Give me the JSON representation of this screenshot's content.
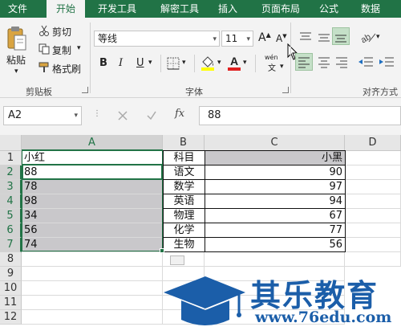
{
  "menu": {
    "tabs": [
      {
        "label": "文件",
        "active": false
      },
      {
        "label": "开始",
        "active": true
      },
      {
        "label": "开发工具",
        "active": false
      },
      {
        "label": "解密工具",
        "active": false
      },
      {
        "label": "插入",
        "active": false
      },
      {
        "label": "页面布局",
        "active": false
      },
      {
        "label": "公式",
        "active": false
      },
      {
        "label": "数据",
        "active": false
      }
    ]
  },
  "ribbon": {
    "clipboard": {
      "paste": "粘贴",
      "cut": "剪切",
      "copy": "复制",
      "format_painter": "格式刷",
      "group_label": "剪贴板"
    },
    "font": {
      "font_name": "等线",
      "font_size": "11",
      "bold": "B",
      "italic": "I",
      "underline": "U",
      "grow": "A",
      "shrink": "A",
      "phonetic": "wén",
      "group_label": "字体"
    },
    "alignment": {
      "group_label": "对齐方式"
    }
  },
  "formula_bar": {
    "name_box": "A2",
    "fx": "fx",
    "value": "88"
  },
  "grid": {
    "columns": [
      "A",
      "B",
      "C",
      "D"
    ],
    "rows": [
      "1",
      "2",
      "3",
      "4",
      "5",
      "6",
      "7",
      "8",
      "9",
      "10",
      "11",
      "12"
    ],
    "cells": {
      "A1": "小红",
      "B1": "科目",
      "C1": "小黑",
      "A2": "88",
      "B2": "语文",
      "C2": "90",
      "A3": "78",
      "B3": "数学",
      "C3": "97",
      "A4": "98",
      "B4": "英语",
      "C4": "94",
      "A5": "34",
      "B5": "物理",
      "C5": "67",
      "A6": "56",
      "B6": "化学",
      "C6": "77",
      "A7": "74",
      "B7": "生物",
      "C7": "56"
    }
  },
  "watermark": {
    "brand": "其乐教育",
    "url": "www.76edu.com"
  },
  "colors": {
    "accent": "#217346",
    "shade": "#c9c8cb",
    "watermark": "#1b5ea9"
  }
}
